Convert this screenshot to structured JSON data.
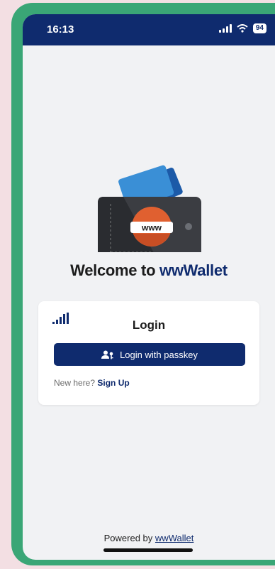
{
  "status_bar": {
    "time": "16:13",
    "battery": "94",
    "icons": [
      "signal-icon",
      "wifi-icon",
      "battery-icon"
    ]
  },
  "logo": {
    "badge_text": "www"
  },
  "welcome": {
    "prefix": "Welcome to ",
    "brand": "wwWallet"
  },
  "login_card": {
    "title": "Login",
    "passkey_button_label": "Login with passkey",
    "new_here_text": "New here?",
    "signup_link": "Sign Up",
    "icons": [
      "connection-signal-icon",
      "user-key-icon"
    ]
  },
  "footer": {
    "powered_by": "Powered by",
    "brand_link": "wwWallet"
  },
  "colors": {
    "primary": "#0f2b6e",
    "frame": "#3aa676",
    "background": "#f1f2f4",
    "logo_orange": "#e06030",
    "logo_blue": "#3a8fd6"
  }
}
